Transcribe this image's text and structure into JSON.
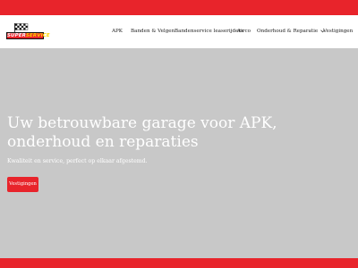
{
  "brand": {
    "logo_text_part1": "SUPER",
    "logo_text_part2": "SERVICE",
    "brand_color": "#e8242b",
    "accent_color": "#ffd400"
  },
  "nav": {
    "items": [
      {
        "label": "APK"
      },
      {
        "label": "Banden & Velgen"
      },
      {
        "label": "Bandenservice leaserijders"
      },
      {
        "label": "Airco"
      },
      {
        "label": "Onderhoud & Reparatie",
        "has_dropdown": true,
        "icon": "chevron-down-icon"
      },
      {
        "label": "Vestigingen"
      }
    ]
  },
  "hero": {
    "title_line1": "Uw betrouwbare garage voor APK,",
    "title_line2": "onderhoud en reparaties",
    "subtitle": "Kwaliteit en service, perfect op elkaar afgestemd.",
    "cta_label": "Vestigingen",
    "background_color": "#c8c8c8"
  }
}
